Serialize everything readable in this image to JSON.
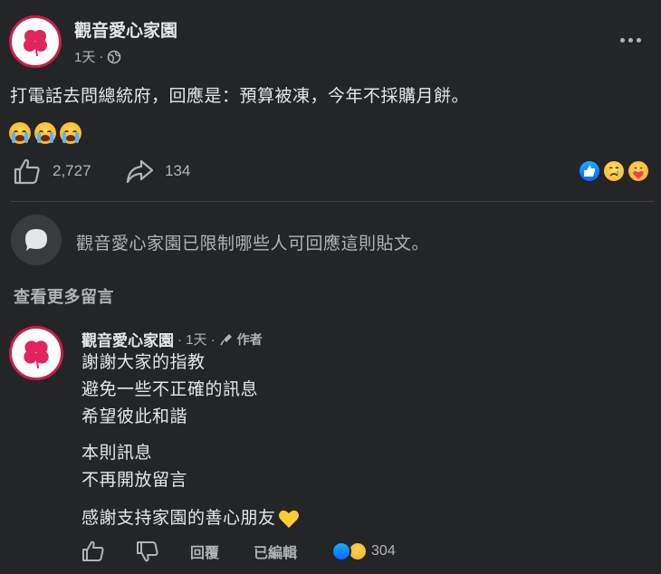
{
  "post": {
    "page_name": "觀音愛心家園",
    "time": "1天",
    "separator": "·",
    "privacy_icon": "globe-icon",
    "more_icon": "more-dots-icon",
    "text": "打電話去問總統府，回應是：預算被凍，今年不採購月餅。",
    "emoji_row": [
      "crying-face",
      "crying-face",
      "crying-face"
    ],
    "like_count": "2,727",
    "share_count": "134",
    "reactions": [
      "like",
      "sad",
      "care"
    ]
  },
  "restriction": {
    "text": "觀音愛心家園已限制哪些人可回應這則貼文。"
  },
  "view_more_comments": "查看更多留言",
  "comment": {
    "author": "觀音愛心家園",
    "time": "· 1天 ·",
    "badge": "作者",
    "badge_icon": "microphone-icon",
    "lines_group1": [
      "謝謝大家的指教",
      "避免一些不正確的訊息",
      "希望彼此和諧"
    ],
    "lines_group2": [
      "本則訊息",
      "不再開放留言"
    ],
    "line_thanks": "感謝支持家園的善心朋友",
    "heart": "💛",
    "reply_label": "回覆",
    "edited_label": "已編輯",
    "reaction_count": "304"
  },
  "colors": {
    "background": "#242526",
    "text_primary": "#e4e6eb",
    "text_secondary": "#b0b3b8",
    "like_blue": "#0866ff",
    "brand_red": "#c81e4b"
  }
}
